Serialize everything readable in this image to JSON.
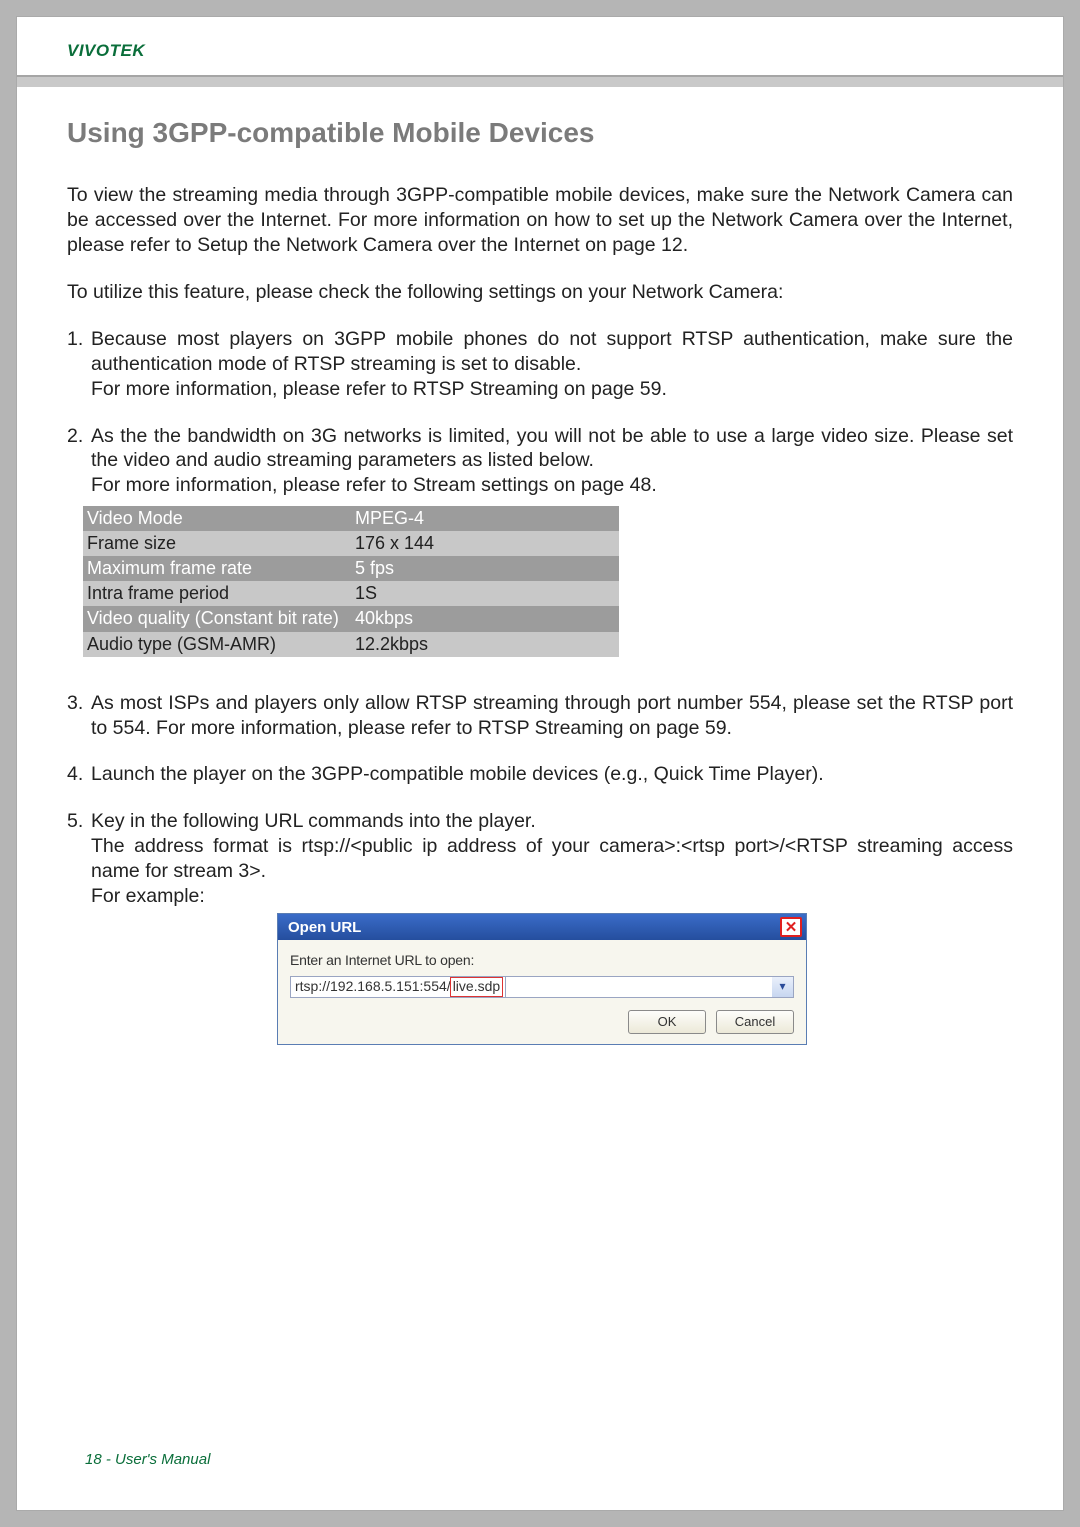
{
  "header": {
    "brand": "VIVOTEK"
  },
  "title": "Using 3GPP-compatible Mobile Devices",
  "intro1": "To view the streaming media through 3GPP-compatible mobile devices, make sure the Network Camera can be accessed over the Internet. For more information on how to set up the Network Camera over the Internet, please refer to Setup the Network Camera over the Internet on page 12.",
  "intro2": "To utilize this feature, please check the following settings on your Network Camera:",
  "steps": {
    "s1": {
      "num": "1.",
      "line1": "Because most players on 3GPP mobile phones do not support RTSP authentication, make sure the authentication mode of RTSP streaming is set to disable.",
      "line2": "For more information, please refer to RTSP Streaming on page 59."
    },
    "s2": {
      "num": "2.",
      "line1": "As the the bandwidth on 3G networks is limited, you will not be able to use a large video size. Please set the video and audio streaming parameters as listed below.",
      "line2": "For more information, please refer to Stream settings on page 48."
    },
    "s3": {
      "num": "3.",
      "line1": "As most ISPs and players only allow RTSP streaming through port number 554, please set the RTSP port to 554. For more information, please refer to RTSP Streaming on page 59."
    },
    "s4": {
      "num": "4.",
      "line1": "Launch the player on the 3GPP-compatible mobile devices (e.g., Quick Time Player)."
    },
    "s5": {
      "num": "5.",
      "line1": "Key in the following URL commands into the player.",
      "line2": "The address format is rtsp://<public ip address of your camera>:<rtsp port>/<RTSP streaming access name for stream 3>.",
      "line3": "For example:"
    }
  },
  "settings": {
    "rows": [
      {
        "k": "Video Mode",
        "v": "MPEG-4"
      },
      {
        "k": "Frame size",
        "v": "176 x 144"
      },
      {
        "k": "Maximum frame rate",
        "v": "5 fps"
      },
      {
        "k": "Intra frame period",
        "v": "1S"
      },
      {
        "k": "Video quality (Constant bit rate)",
        "v": "40kbps"
      },
      {
        "k": "Audio type (GSM-AMR)",
        "v": "12.2kbps"
      }
    ]
  },
  "dialog": {
    "title": "Open URL",
    "label": "Enter an Internet URL to open:",
    "url_prefix": "rtsp://192.168.5.151:554/",
    "url_highlight": "live.sdp",
    "ok": "OK",
    "cancel": "Cancel"
  },
  "footer": "18 - User's Manual"
}
